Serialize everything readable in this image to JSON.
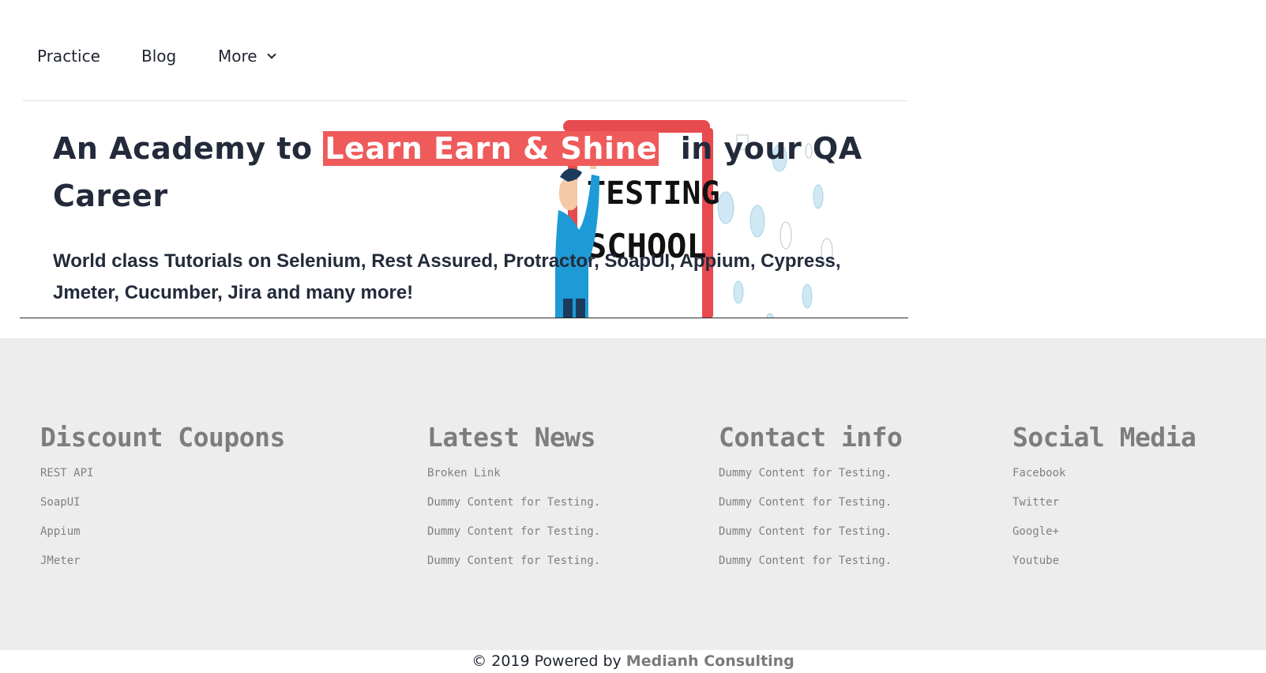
{
  "nav": {
    "items": [
      {
        "label": "Practice"
      },
      {
        "label": "Blog"
      },
      {
        "label": "More"
      }
    ]
  },
  "hero": {
    "title_prefix": "An Academy to ",
    "title_highlight": "Learn Earn & Shine",
    "title_suffix": "  in your QA Career",
    "subtitle": "World class Tutorials on Selenium, Rest Assured, Protractor, SoapUI, Appium, Cypress, Jmeter, Cucumber, Jira and many more!",
    "illustration": {
      "line1": "TESTING",
      "line2": "SCHOOL",
      "accent_color": "#e84b4f",
      "figure_color": "#1e9ad6",
      "bubble_color": "#cfe8f3"
    },
    "highlight_color": "#ef5a5a"
  },
  "footer": {
    "columns": [
      {
        "title": "Discount Coupons",
        "items": [
          "REST API",
          "SoapUI",
          "Appium",
          "JMeter"
        ]
      },
      {
        "title": "Latest News",
        "items": [
          "Broken Link",
          "Dummy Content for Testing.",
          "Dummy Content for Testing.",
          "Dummy Content for Testing."
        ]
      },
      {
        "title": "Contact info",
        "items": [
          "Dummy Content for Testing.",
          "Dummy Content for Testing.",
          "Dummy Content for Testing.",
          "Dummy Content for Testing."
        ]
      },
      {
        "title": "Social Media",
        "items": [
          "Facebook",
          "Twitter",
          "Google+",
          "Youtube"
        ]
      }
    ],
    "background": "#ededed"
  },
  "copyright": {
    "prefix": "© 2019 Powered by ",
    "brand": "Medianh Consulting"
  }
}
